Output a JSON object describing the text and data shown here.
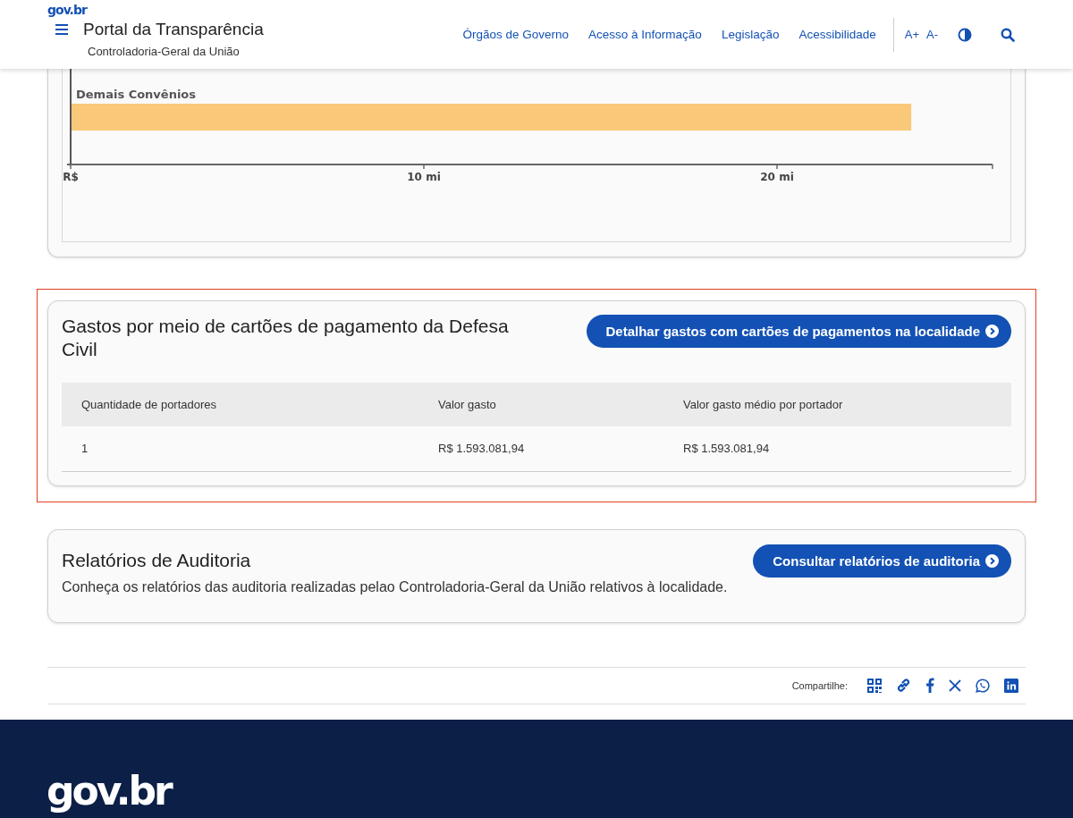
{
  "header": {
    "logo": "gov.br",
    "title": "Portal da Transparência",
    "subtitle": "Controladoria-Geral da União",
    "nav": [
      "Órgãos de Governo",
      "Acesso à Informação",
      "Legislação",
      "Acessibilidade"
    ],
    "font_increase": "A+",
    "font_decrease": "A-"
  },
  "chart_card": {
    "chart_data": {
      "type": "bar",
      "orientation": "horizontal",
      "categories": [
        "Demais Convênios"
      ],
      "series": [
        {
          "color": "#f9c879",
          "values": [
            23.8
          ]
        }
      ],
      "xlim": [
        0,
        26.1
      ],
      "xticks": [
        {
          "value": 0,
          "label": "R$"
        },
        {
          "value": 10,
          "label": "10 mi"
        },
        {
          "value": 20,
          "label": "20 mi"
        }
      ]
    }
  },
  "cards_card": {
    "highlighted": true,
    "title": "Gastos por meio de cartões de pagamento da Defesa Civil",
    "button": "Detalhar gastos com cartões de pagamentos na localidade",
    "columns": [
      "Quantidade de portadores",
      "Valor gasto",
      "Valor gasto médio por portador"
    ],
    "rows": [
      [
        "1",
        "R$ 1.593.081,94",
        "R$ 1.593.081,94"
      ]
    ]
  },
  "audit_card": {
    "title": "Relatórios de Auditoria",
    "button": "Consultar relatórios de auditoria",
    "description": "Conheça os relatórios das auditoria realizadas pelao Controladoria-Geral da União relativos à localidade."
  },
  "share": {
    "label": "Compartilhe:"
  },
  "footer": {
    "logo": "gov.br"
  }
}
